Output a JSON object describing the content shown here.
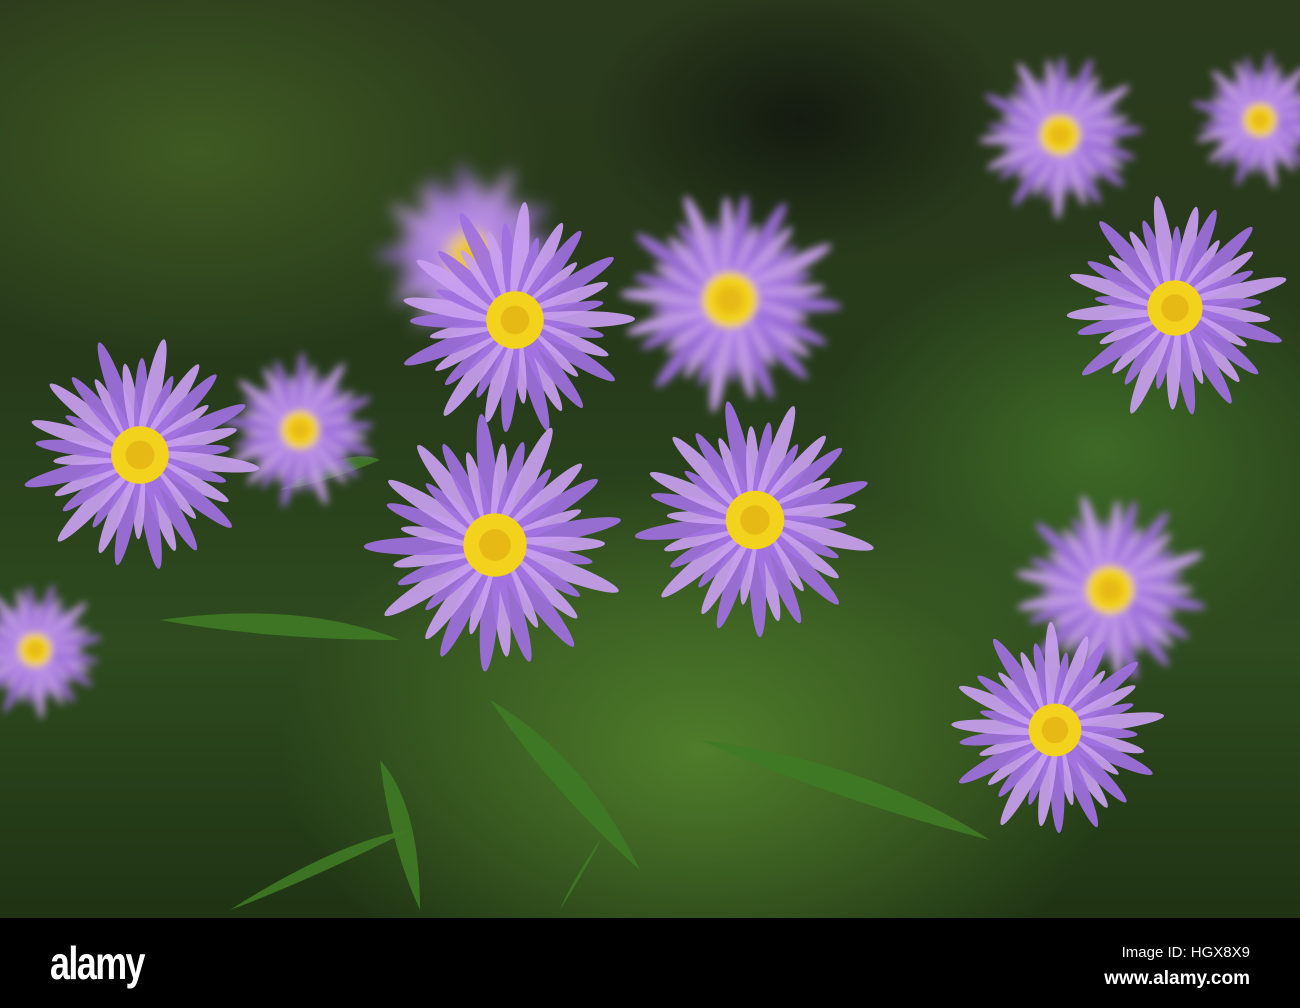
{
  "photo": {
    "subject": "Purple aster flowers",
    "colors": {
      "petal": "#a070e0",
      "petal_light": "#c9a0f0",
      "center": "#f2d21c",
      "leaf": "#3f7a25"
    }
  },
  "watermark": "alamy",
  "footer": {
    "logo": "alamy",
    "image_id": "Image ID: HGX8X9",
    "url": "www.alamy.com"
  }
}
